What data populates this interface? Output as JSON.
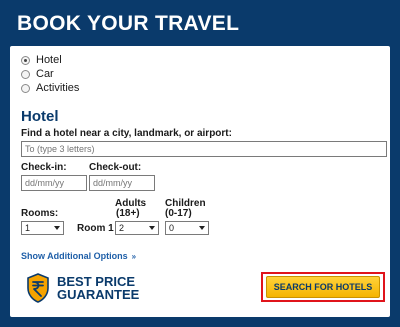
{
  "widget": {
    "title": "BOOK YOUR TRAVEL"
  },
  "search_type": {
    "options": [
      {
        "label": "Hotel",
        "checked": true
      },
      {
        "label": "Car",
        "checked": false
      },
      {
        "label": "Activities",
        "checked": false
      }
    ]
  },
  "hotel": {
    "heading": "Hotel",
    "location_label": "Find a hotel near a city, landmark, or airport:",
    "location_placeholder": "To (type 3 letters)",
    "checkin_label": "Check-in:",
    "checkin_placeholder": "dd/mm/yy",
    "checkout_label": "Check-out:",
    "checkout_placeholder": "dd/mm/yy",
    "rooms_label": "Rooms:",
    "rooms_value": "1",
    "room_row_label": "Room 1",
    "adults_label": "Adults",
    "adults_sub": "(18+)",
    "adults_value": "2",
    "children_label": "Children",
    "children_sub": "(0-17)",
    "children_value": "0",
    "more_options": "Show Additional Options",
    "more_options_icon": "double-chevron-down"
  },
  "guarantee": {
    "line1": "BEST PRICE",
    "line2": "GUARANTEE",
    "icon": "rupee-badge-icon"
  },
  "search_button": {
    "label": "SEARCH FOR HOTELS"
  },
  "colors": {
    "brand_navy": "#0a3a6b",
    "button_yellow": "#f5b400",
    "highlight_red": "#e0141b",
    "link_blue": "#1f5fa8"
  }
}
